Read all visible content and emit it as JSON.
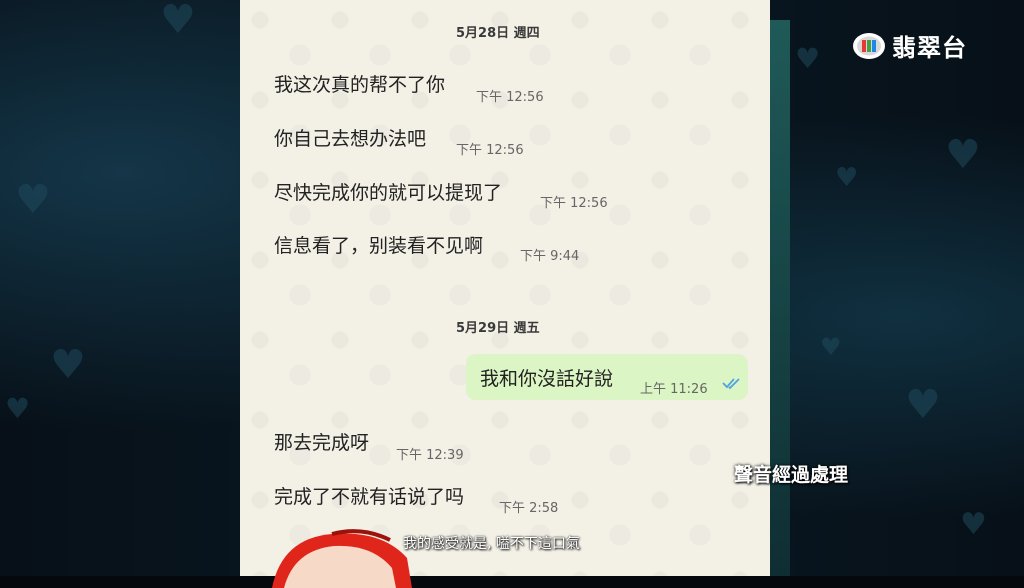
{
  "broadcast": {
    "channel_logo_text": "翡翠台",
    "processed_label": "聲音經過處理",
    "subtitle": "我的感受就是, 嗌不下這口氣"
  },
  "chat": {
    "date_1": "5月28日 週四",
    "date_2": "5月29日 週五",
    "messages": [
      {
        "text": "我这次真的帮不了你",
        "time": "下午 12:56",
        "direction": "in"
      },
      {
        "text": "你自己去想办法吧",
        "time": "下午 12:56",
        "direction": "in"
      },
      {
        "text": "尽快完成你的就可以提现了",
        "time": "下午 12:56",
        "direction": "in"
      },
      {
        "text": "信息看了，别装看不见啊",
        "time": "下午 9:44",
        "direction": "in"
      },
      {
        "text": "我和你沒話好說",
        "time": "上午 11:26",
        "direction": "out"
      },
      {
        "text": "那去完成呀",
        "time": "下午 12:39",
        "direction": "in"
      },
      {
        "text": "完成了不就有话说了吗",
        "time": "下午 2:58",
        "direction": "in"
      }
    ],
    "read_receipt_icon": "double-check-icon",
    "read_receipt_color": "#4fa3e0",
    "outgoing_bubble_color": "#dcf5c4",
    "background_color": "#f3f0e6"
  }
}
